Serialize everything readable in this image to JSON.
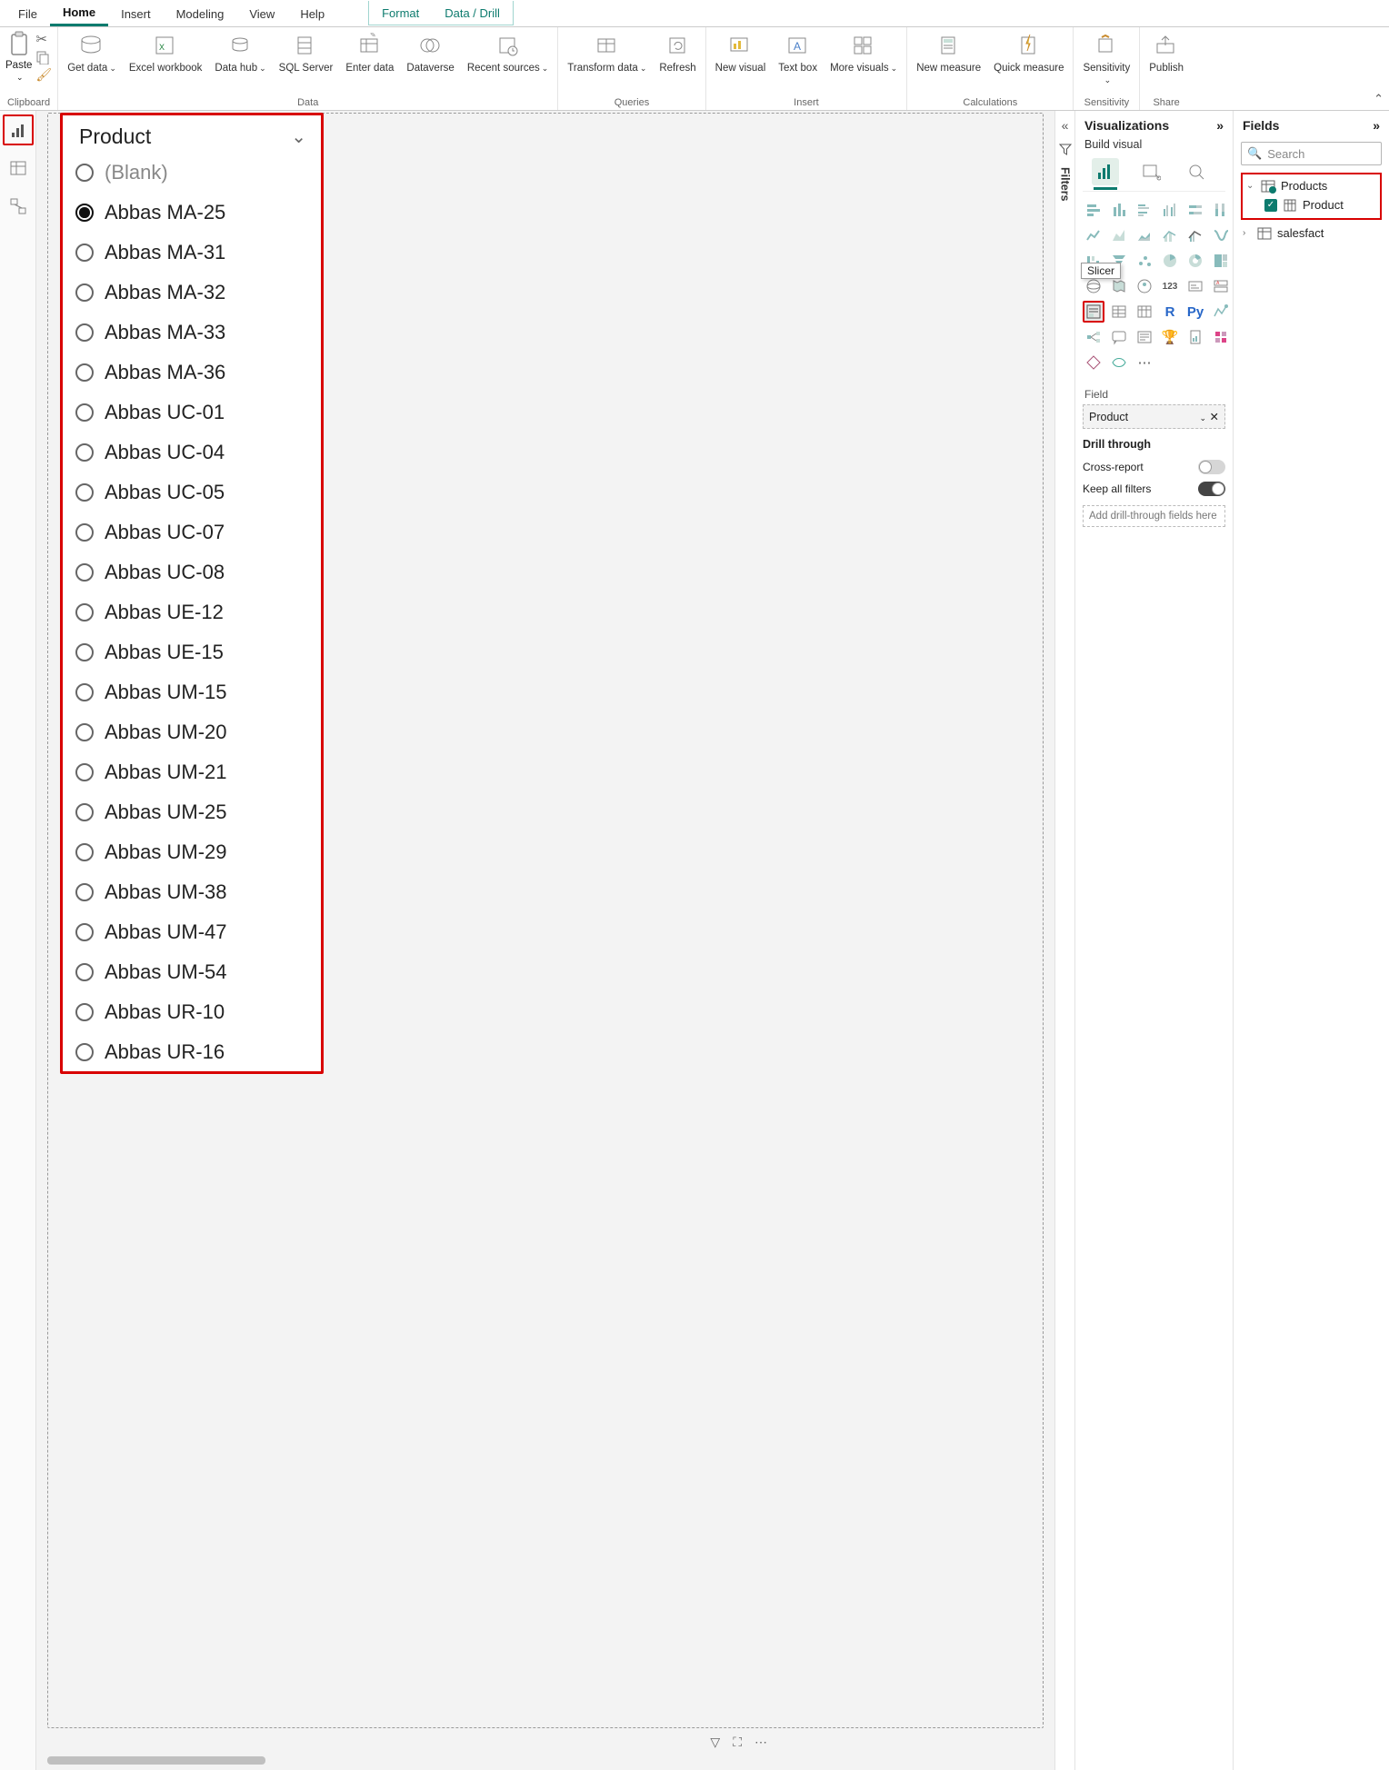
{
  "ribbon": {
    "tabs": [
      "File",
      "Home",
      "Insert",
      "Modeling",
      "View",
      "Help",
      "Format",
      "Data / Drill"
    ],
    "active": "Home",
    "groups": {
      "clipboard": {
        "label": "Clipboard",
        "paste": "Paste"
      },
      "data": {
        "label": "Data",
        "get_data": "Get data",
        "excel": "Excel workbook",
        "datahub": "Data hub",
        "sql": "SQL Server",
        "enter": "Enter data",
        "dataverse": "Dataverse",
        "recent": "Recent sources"
      },
      "queries": {
        "label": "Queries",
        "transform": "Transform data",
        "refresh": "Refresh"
      },
      "insert": {
        "label": "Insert",
        "newvis": "New visual",
        "textbox": "Text box",
        "morevis": "More visuals"
      },
      "calcs": {
        "label": "Calculations",
        "newmeasure": "New measure",
        "quickmeasure": "Quick measure"
      },
      "sensitivity": {
        "label": "Sensitivity",
        "btn": "Sensitivity"
      },
      "share": {
        "label": "Share",
        "publish": "Publish"
      }
    }
  },
  "filters_rail": "Filters",
  "slicer": {
    "title": "Product",
    "tooltip": "Slicer",
    "selected_index": 1,
    "items": [
      "(Blank)",
      "Abbas MA-25",
      "Abbas MA-31",
      "Abbas MA-32",
      "Abbas MA-33",
      "Abbas MA-36",
      "Abbas UC-01",
      "Abbas UC-04",
      "Abbas UC-05",
      "Abbas UC-07",
      "Abbas UC-08",
      "Abbas UE-12",
      "Abbas UE-15",
      "Abbas UM-15",
      "Abbas UM-20",
      "Abbas UM-21",
      "Abbas UM-25",
      "Abbas UM-29",
      "Abbas UM-38",
      "Abbas UM-47",
      "Abbas UM-54",
      "Abbas UR-10",
      "Abbas UR-16"
    ]
  },
  "viz_pane": {
    "title": "Visualizations",
    "subtitle": "Build visual",
    "field_label": "Field",
    "field_value": "Product",
    "drill": {
      "title": "Drill through",
      "cross": "Cross-report",
      "cross_state": "Off",
      "keep": "Keep all filters",
      "keep_state": "On",
      "add": "Add drill-through fields here"
    }
  },
  "fields_pane": {
    "title": "Fields",
    "search_placeholder": "Search",
    "tables": [
      {
        "name": "Products",
        "expanded": true,
        "checked": true,
        "columns": [
          {
            "name": "Product",
            "checked": true
          }
        ]
      },
      {
        "name": "salesfact",
        "expanded": false
      }
    ]
  }
}
